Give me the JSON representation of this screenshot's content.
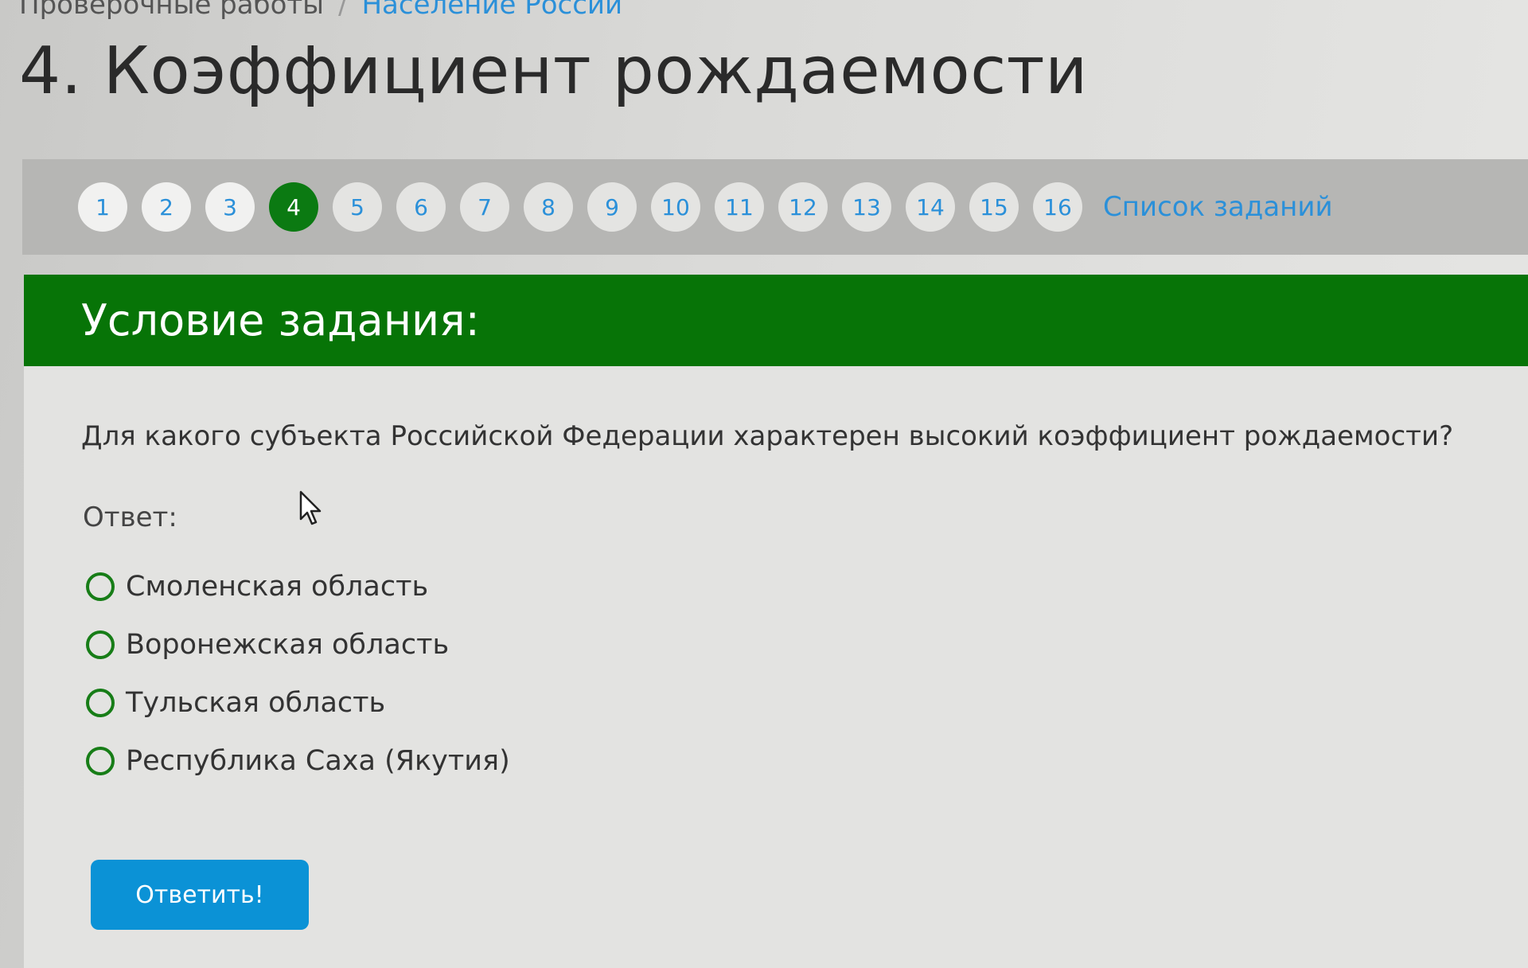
{
  "breadcrumb": {
    "parent": "Проверочные работы",
    "separator": "/",
    "current": "Население России"
  },
  "page_title": "4. Коэффициент рождаемости",
  "pager": {
    "items": [
      {
        "label": "1",
        "state": "visited"
      },
      {
        "label": "2",
        "state": "visited"
      },
      {
        "label": "3",
        "state": "visited"
      },
      {
        "label": "4",
        "state": "active"
      },
      {
        "label": "5",
        "state": "normal"
      },
      {
        "label": "6",
        "state": "normal"
      },
      {
        "label": "7",
        "state": "normal"
      },
      {
        "label": "8",
        "state": "normal"
      },
      {
        "label": "9",
        "state": "normal"
      },
      {
        "label": "10",
        "state": "normal"
      },
      {
        "label": "11",
        "state": "normal"
      },
      {
        "label": "12",
        "state": "normal"
      },
      {
        "label": "13",
        "state": "normal"
      },
      {
        "label": "14",
        "state": "normal"
      },
      {
        "label": "15",
        "state": "normal"
      },
      {
        "label": "16",
        "state": "normal"
      }
    ],
    "task_list_label": "Список заданий"
  },
  "task": {
    "header": "Условие задания:",
    "question": "Для какого субъекта Российской Федерации характерен высокий коэффициент рождаемости?",
    "answer_label": "Ответ:",
    "options": [
      "Смоленская область",
      "Воронежская область",
      "Тульская область",
      "Республика Саха (Якутия)"
    ],
    "submit_label": "Ответить!"
  },
  "colors": {
    "accent_green": "#077407",
    "link_blue": "#2b90d9",
    "button_blue": "#0b92d6"
  },
  "icons": {
    "cursor": "mouse-pointer-icon"
  }
}
